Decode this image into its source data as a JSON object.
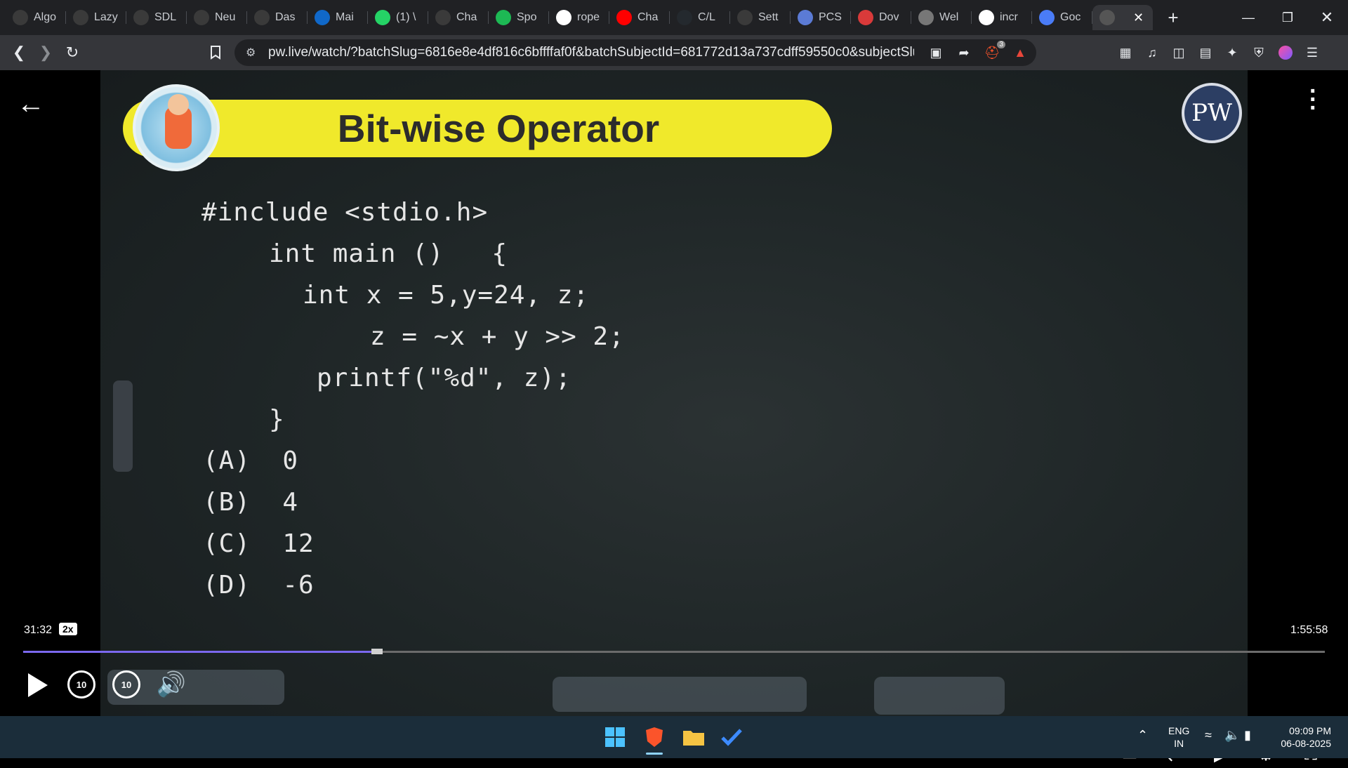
{
  "browser": {
    "tabs": [
      {
        "label": "Algo",
        "icon": "openai-icon",
        "color": "#3a3a3a"
      },
      {
        "label": "Lazy",
        "icon": "openai-icon",
        "color": "#3a3a3a"
      },
      {
        "label": "SDL",
        "icon": "openai-icon",
        "color": "#3a3a3a"
      },
      {
        "label": "Neu",
        "icon": "openai-icon",
        "color": "#3a3a3a"
      },
      {
        "label": "Das",
        "icon": "openai-icon",
        "color": "#3a3a3a"
      },
      {
        "label": "Mai",
        "icon": "outlook-icon",
        "color": "#1068c9"
      },
      {
        "label": "(1) \\",
        "icon": "whatsapp-icon",
        "color": "#25d366"
      },
      {
        "label": "Cha",
        "icon": "openai-icon",
        "color": "#3a3a3a"
      },
      {
        "label": "Spo",
        "icon": "spotify-icon",
        "color": "#1db954"
      },
      {
        "label": "rope",
        "icon": "google-icon",
        "color": "#ffffff"
      },
      {
        "label": "Cha",
        "icon": "youtube-icon",
        "color": "#ff0000"
      },
      {
        "label": "C/L",
        "icon": "github-icon",
        "color": "#24292e"
      },
      {
        "label": "Sett",
        "icon": "gear-icon",
        "color": "#3a3a3a"
      },
      {
        "label": "PCS",
        "icon": "pcs-icon",
        "color": "#5b7bd5"
      },
      {
        "label": "Dov",
        "icon": "dov-icon",
        "color": "#d93a3a"
      },
      {
        "label": "Wel",
        "icon": "wel-icon",
        "color": "#777777"
      },
      {
        "label": "incr",
        "icon": "google-icon",
        "color": "#ffffff"
      },
      {
        "label": "Goc",
        "icon": "gemini-icon",
        "color": "#4a7cf7"
      }
    ],
    "active_tab_close": "✕",
    "new_tab": "+",
    "url": "pw.live/watch/?batchSlug=6816e8e4df816c6bffffaf0f&batchSubjectId=681772d13a737cdff59550c0&subjectSlug=68...",
    "brave_badge": "3"
  },
  "slide": {
    "title": "Bit-wise Operator",
    "logo_text": "PW",
    "code_lines": [
      "#include <stdio.h>",
      "int main ()   {",
      "int x = 5,y=24, z;",
      "z = ~x + y >> 2;",
      "printf(\"%d\", z);",
      "}"
    ],
    "options": [
      "(A)  0",
      "(B)  4",
      "(C)  12",
      "(D)  -6"
    ]
  },
  "player": {
    "current_time": "31:32",
    "speed": "2x",
    "duration": "1:55:58",
    "progress_fraction": 0.272,
    "rewind_label": "10",
    "forward_label": "10"
  },
  "taskbar": {
    "lang_top": "ENG",
    "lang_bottom": "IN",
    "time": "09:09 PM",
    "date": "06-08-2025"
  }
}
